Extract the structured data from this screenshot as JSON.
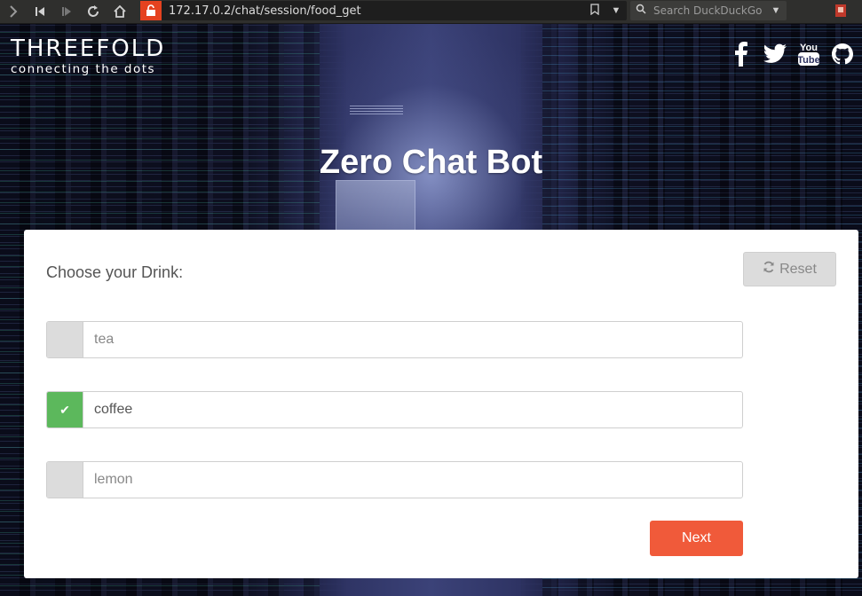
{
  "browser": {
    "url": "172.17.0.2/chat/session/food_get",
    "search_placeholder": "Search DuckDuckGo"
  },
  "site": {
    "brand_name": "THREEFOLD",
    "brand_tagline": "connecting the dots",
    "title": "Zero Chat Bot",
    "social_icons": [
      "facebook-icon",
      "twitter-icon",
      "youtube-icon",
      "github-icon"
    ]
  },
  "form": {
    "question": "Choose your Drink:",
    "reset_label": "Reset",
    "options": [
      {
        "label": "tea",
        "checked": false
      },
      {
        "label": "coffee",
        "checked": true
      },
      {
        "label": "lemon",
        "checked": false
      }
    ],
    "next_label": "Next"
  },
  "colors": {
    "accent": "#f05a3a",
    "checked": "#5cb85c",
    "lock": "#e5421f"
  }
}
